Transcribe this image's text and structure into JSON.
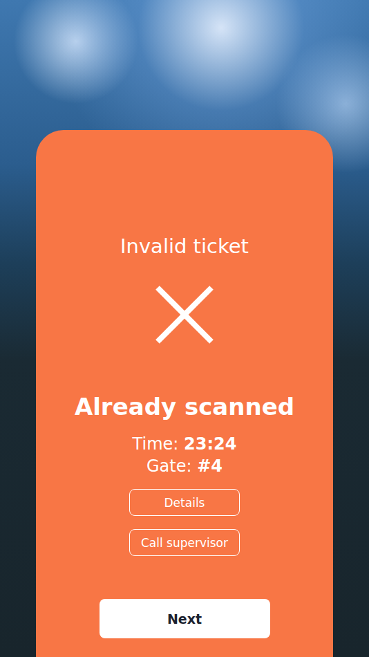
{
  "title": "Invalid ticket",
  "status": {
    "valid": false
  },
  "message": "Already scanned",
  "info": [
    {
      "label": "Time:",
      "value": "23:24"
    },
    {
      "label": "Gate:",
      "value": "#4"
    }
  ],
  "actions": [
    "Details",
    "Call supervisor"
  ],
  "primary_button": "Next"
}
